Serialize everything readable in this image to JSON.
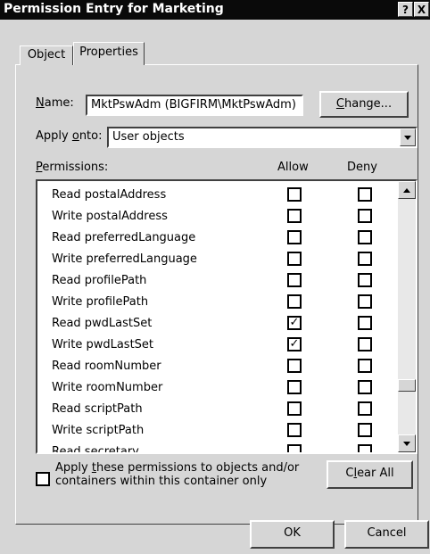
{
  "window": {
    "title": "Permission Entry for Marketing",
    "help_glyph": "?",
    "close_glyph": "X"
  },
  "tabs": [
    {
      "label": "Object",
      "selected": false
    },
    {
      "label": "Properties",
      "selected": true
    }
  ],
  "name": {
    "label_prefix": "",
    "label_access": "N",
    "label_rest": "ame:",
    "value": "MktPswAdm (BIGFIRM\\MktPswAdm)"
  },
  "change_button": {
    "access": "C",
    "rest": "hange..."
  },
  "apply_onto": {
    "label_pre": "Apply ",
    "label_access": "o",
    "label_rest": "nto:",
    "value": "User objects"
  },
  "permissions": {
    "label_access": "P",
    "label_rest": "ermissions:",
    "allow_header": "Allow",
    "deny_header": "Deny",
    "rows": [
      {
        "name": "Read postalAddress",
        "allow": false,
        "deny": false
      },
      {
        "name": "Write postalAddress",
        "allow": false,
        "deny": false
      },
      {
        "name": "Read preferredLanguage",
        "allow": false,
        "deny": false
      },
      {
        "name": "Write preferredLanguage",
        "allow": false,
        "deny": false
      },
      {
        "name": "Read profilePath",
        "allow": false,
        "deny": false
      },
      {
        "name": "Write profilePath",
        "allow": false,
        "deny": false
      },
      {
        "name": "Read pwdLastSet",
        "allow": true,
        "deny": false
      },
      {
        "name": "Write pwdLastSet",
        "allow": true,
        "deny": false
      },
      {
        "name": "Read roomNumber",
        "allow": false,
        "deny": false
      },
      {
        "name": "Write roomNumber",
        "allow": false,
        "deny": false
      },
      {
        "name": "Read scriptPath",
        "allow": false,
        "deny": false
      },
      {
        "name": "Write scriptPath",
        "allow": false,
        "deny": false
      },
      {
        "name": "Read secretary",
        "allow": false,
        "deny": false
      }
    ]
  },
  "apply_within": {
    "checked": false,
    "pre": "Apply ",
    "access": "t",
    "rest": "hese permissions to objects and/or containers within this container only"
  },
  "clear_all_button": {
    "pre": "C",
    "access": "l",
    "rest": "ear All"
  },
  "ok_button": "OK",
  "cancel_button": "Cancel",
  "check_glyph": "✓"
}
